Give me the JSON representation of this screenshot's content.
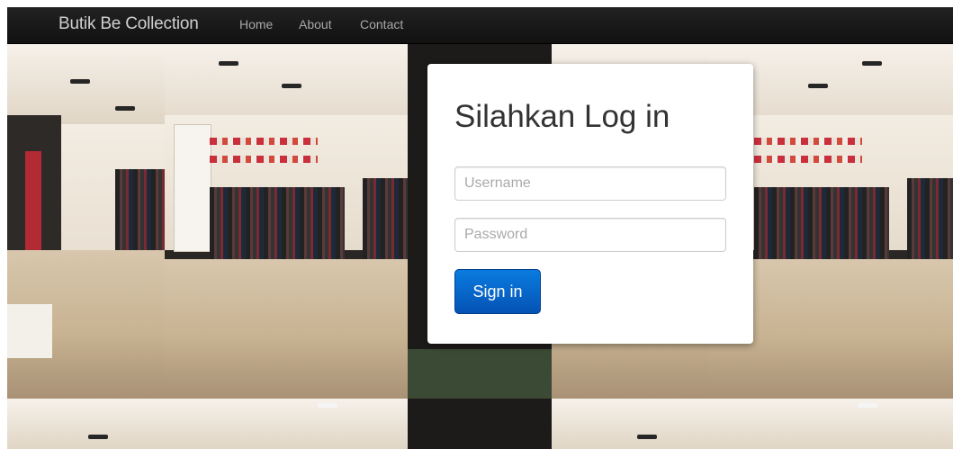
{
  "navbar": {
    "brand": "Butik Be Collection",
    "links": [
      {
        "label": "Home"
      },
      {
        "label": "About"
      },
      {
        "label": "Contact"
      }
    ]
  },
  "login": {
    "title": "Silahkan Log in",
    "username_placeholder": "Username",
    "password_placeholder": "Password",
    "submit_label": "Sign in"
  },
  "colors": {
    "navbar_bg": "#1b1b1b",
    "button_primary": "#0663c7",
    "card_bg": "#ffffff"
  }
}
